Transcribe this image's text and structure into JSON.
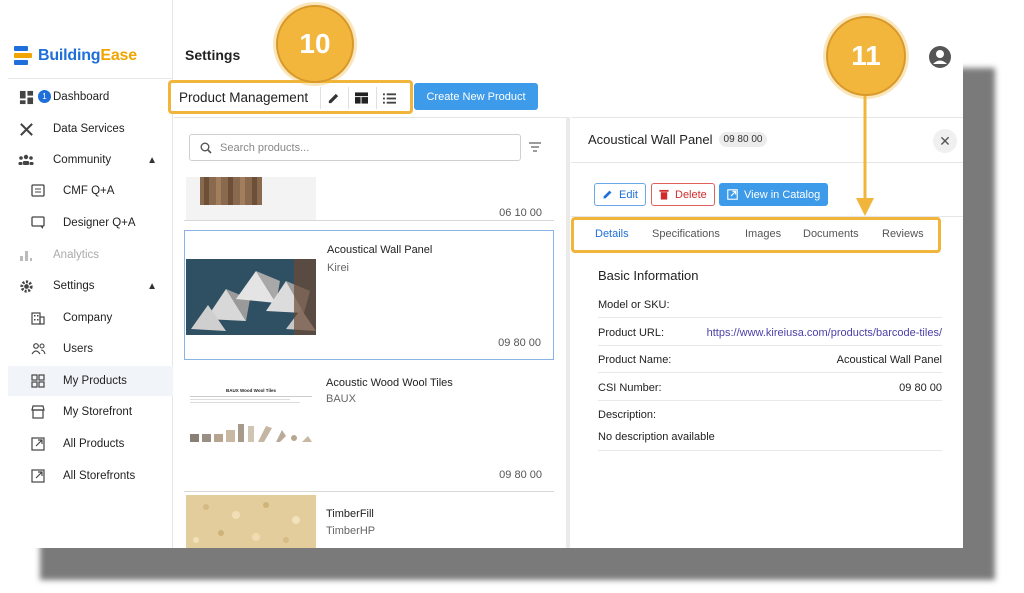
{
  "brand": {
    "name_a": "Building",
    "name_b": "Ease"
  },
  "header": {
    "title": "Settings"
  },
  "sidebar": {
    "items": [
      {
        "label": "Dashboard",
        "icon": "dashboard-icon",
        "badge": "1"
      },
      {
        "label": "Data Services",
        "icon": "tools-icon"
      },
      {
        "label": "Community",
        "icon": "community-icon"
      },
      {
        "label": "CMF Q+A",
        "icon": "qa-icon"
      },
      {
        "label": "Designer Q+A",
        "icon": "chat-icon"
      },
      {
        "label": "Analytics",
        "icon": "analytics-icon"
      },
      {
        "label": "Settings",
        "icon": "gear-icon"
      },
      {
        "label": "Company",
        "icon": "building-icon"
      },
      {
        "label": "Users",
        "icon": "users-icon"
      },
      {
        "label": "My Products",
        "icon": "grid-icon"
      },
      {
        "label": "My Storefront",
        "icon": "storefront-icon"
      },
      {
        "label": "All Products",
        "icon": "external-link-icon"
      },
      {
        "label": "All Storefronts",
        "icon": "external-link-icon"
      }
    ]
  },
  "toolbar": {
    "title": "Product Management",
    "create_label": "Create New Product"
  },
  "search": {
    "placeholder": "Search products..."
  },
  "products": [
    {
      "name": "",
      "brand": "",
      "csi": "06 10 00"
    },
    {
      "name": "Acoustical Wall Panel",
      "brand": "Kirei",
      "csi": "09 80 00"
    },
    {
      "name": "Acoustic Wood Wool Tiles",
      "brand": "BAUX",
      "csi": "09 80 00",
      "thumb_caption": "BAUX Wood Wool Tiles"
    },
    {
      "name": "TimberFill",
      "brand": "TimberHP",
      "csi": ""
    }
  ],
  "detail": {
    "title": "Acoustical Wall Panel",
    "chip": "09 80 00",
    "edit_label": "Edit",
    "delete_label": "Delete",
    "view_label": "View in Catalog",
    "tabs": [
      "Details",
      "Specifications",
      "Images",
      "Documents",
      "Reviews"
    ],
    "section_title": "Basic Information",
    "fields": [
      {
        "key": "Model or SKU:",
        "value": ""
      },
      {
        "key": "Product URL:",
        "value": "https://www.kireiusa.com/products/barcode-tiles/"
      },
      {
        "key": "Product Name:",
        "value": "Acoustical Wall Panel"
      },
      {
        "key": "CSI Number:",
        "value": "09 80 00"
      }
    ],
    "description_label": "Description:",
    "description_value": "No description available"
  },
  "callouts": {
    "a": "10",
    "b": "11"
  },
  "colors": {
    "accent": "#3d9be9",
    "highlight": "#f0b53a",
    "danger": "#d02c2c"
  }
}
